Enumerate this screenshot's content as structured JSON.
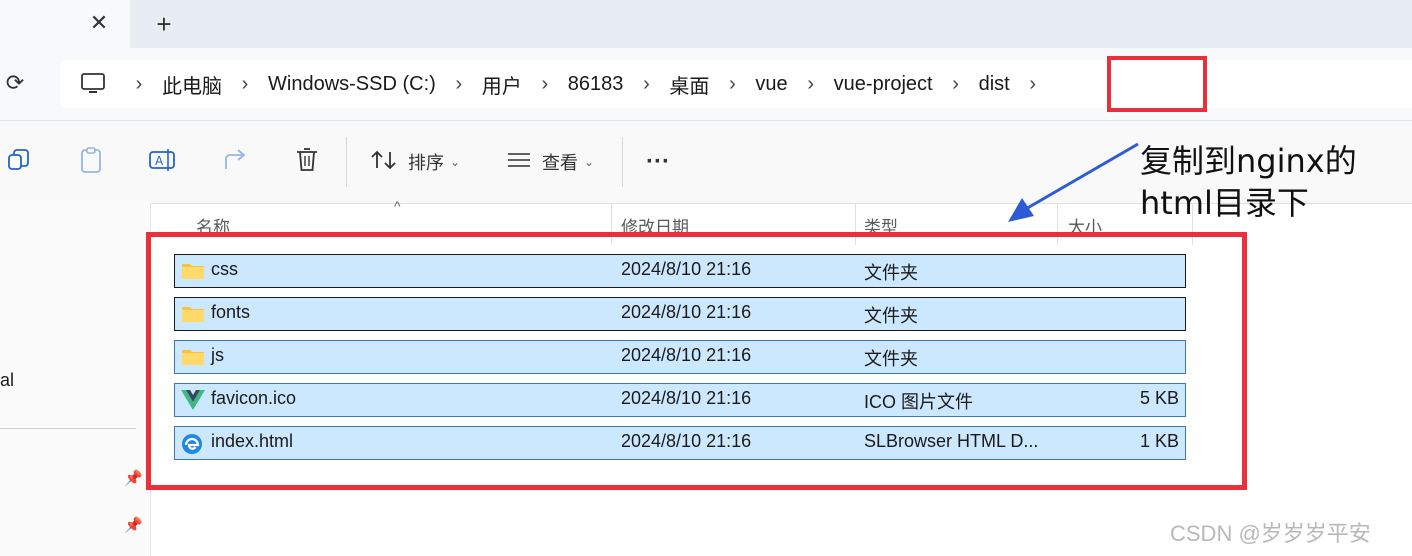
{
  "tab": {
    "close_glyph": "✕",
    "new_glyph": "+"
  },
  "nav": {
    "refresh_glyph": "⟳"
  },
  "breadcrumb": {
    "items": [
      "此电脑",
      "Windows-SSD (C:)",
      "用户",
      "86183",
      "桌面",
      "vue",
      "vue-project",
      "dist"
    ],
    "separator": "›"
  },
  "commandbar": {
    "sort_label": "排序",
    "view_label": "查看",
    "more_label": "···"
  },
  "sidebar": {
    "partial_text": "al"
  },
  "columns": {
    "name": "名称",
    "modified": "修改日期",
    "type": "类型",
    "size": "大小"
  },
  "files": [
    {
      "name": "css",
      "modified": "2024/8/10 21:16",
      "type": "文件夹",
      "size": "",
      "icon": "folder-icon"
    },
    {
      "name": "fonts",
      "modified": "2024/8/10 21:16",
      "type": "文件夹",
      "size": "",
      "icon": "folder-icon"
    },
    {
      "name": "js",
      "modified": "2024/8/10 21:16",
      "type": "文件夹",
      "size": "",
      "icon": "folder-icon"
    },
    {
      "name": "favicon.ico",
      "modified": "2024/8/10 21:16",
      "type": "ICO 图片文件",
      "size": "5 KB",
      "icon": "vue-logo-icon"
    },
    {
      "name": "index.html",
      "modified": "2024/8/10 21:16",
      "type": "SLBrowser HTML D...",
      "size": "1 KB",
      "icon": "browser-icon"
    }
  ],
  "annotation": {
    "line1": "复制到nginx的",
    "line2": "html目录下"
  },
  "watermark": "CSDN @岁岁岁平安",
  "colors": {
    "highlight_red": "#e8313a",
    "selection_blue": "#cce8ff",
    "arrow_blue": "#2d5bd3"
  }
}
